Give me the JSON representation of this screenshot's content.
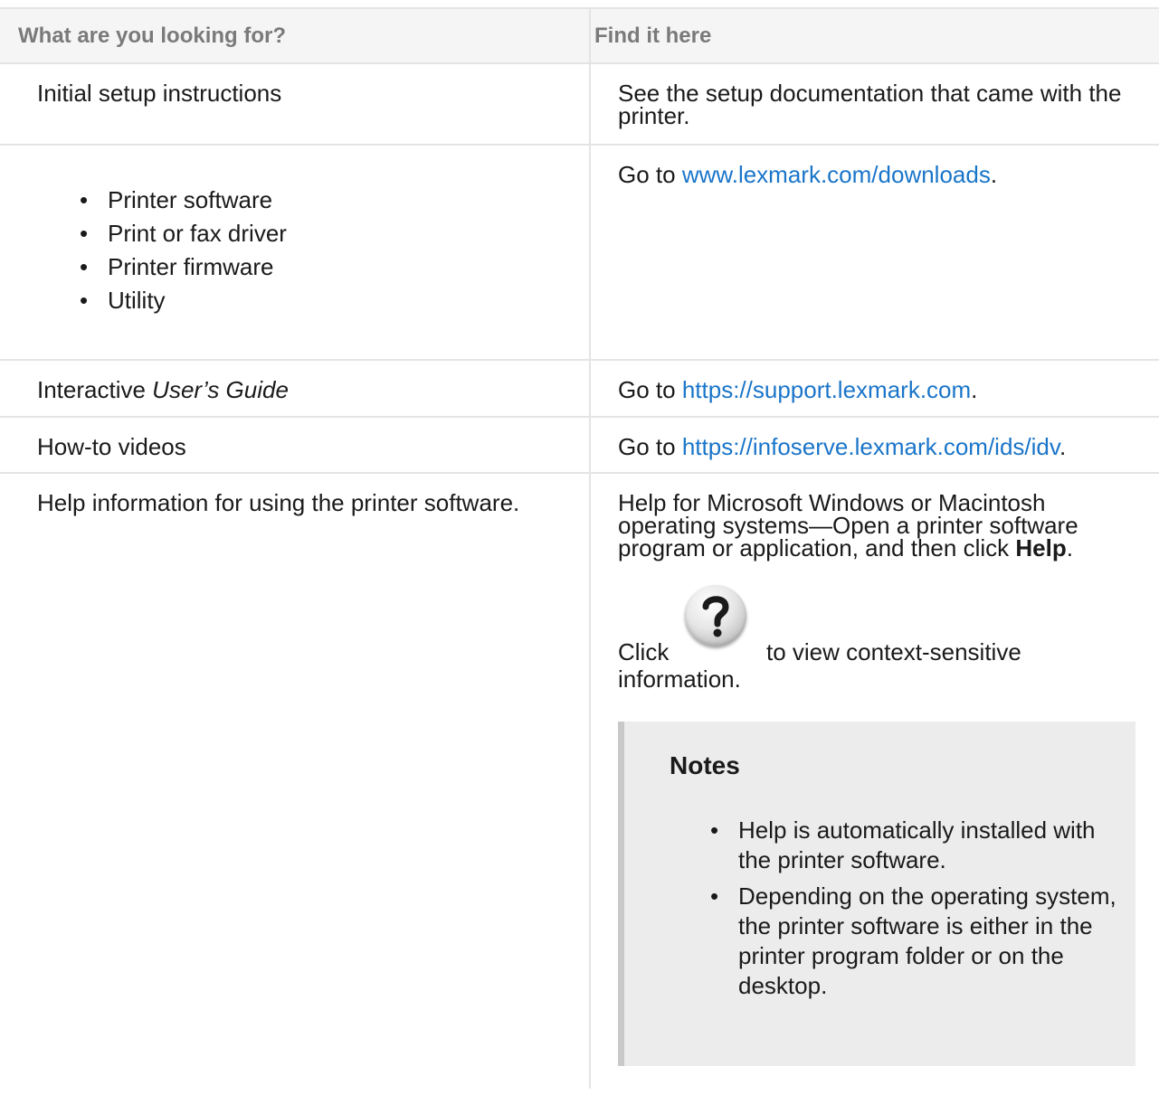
{
  "header": {
    "col1": "What are you looking for?",
    "col2": "Find it here"
  },
  "rows": {
    "setup": {
      "looking_for": "Initial setup instructions",
      "find_here": "See the setup documentation that came with the printer."
    },
    "software": {
      "items": [
        "Printer software",
        "Print or fax driver",
        "Printer firmware",
        "Utility"
      ],
      "prefix": "Go to ",
      "link": "www.lexmark.com/downloads",
      "suffix": "."
    },
    "guide": {
      "looking_for_prefix": "Interactive ",
      "looking_for_em": "User’s Guide",
      "prefix": "Go to ",
      "link": "https://support.lexmark.com",
      "suffix": "."
    },
    "videos": {
      "looking_for": "How-to videos",
      "prefix": "Go to ",
      "link": "https://infoserve.lexmark.com/ids/idv",
      "suffix": "."
    },
    "help": {
      "looking_for": "Help information for using the printer software.",
      "text_before_bold": "Help for Microsoft Windows or Macintosh operating systems—Open a printer software program or application, and then click ",
      "bold": "Help",
      "text_after_bold": ".",
      "click_word": "Click",
      "click_rest": "to view context-sensitive",
      "click_wrap": "information.",
      "icon": "help-question-icon",
      "notes_title": "Notes",
      "notes": [
        "Help is automatically installed with the printer software.",
        "Depending on the operating system, the printer software is either in the printer program folder or on the desktop."
      ]
    }
  },
  "colors": {
    "link": "#1a75c9",
    "header_text": "#7a7a7a",
    "notes_bg": "#ececec"
  }
}
